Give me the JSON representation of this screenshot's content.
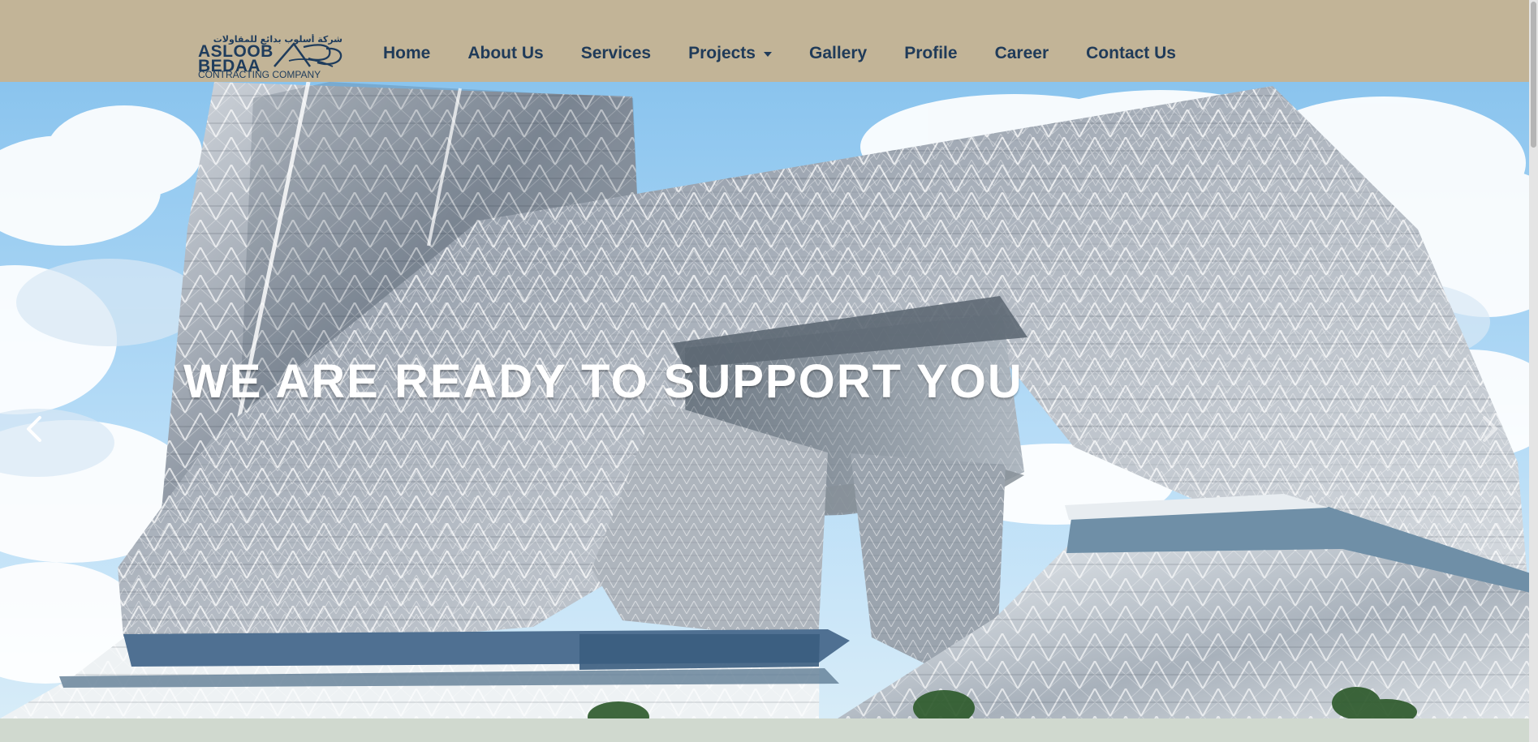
{
  "logo": {
    "arabic_name": "شركة أسلوب بدائع للمقاولات",
    "line1": "ASLOOB",
    "line2": "BEDAA",
    "line3": "CONTRACTING COMPANY",
    "mark": "ABC"
  },
  "nav": {
    "items": [
      {
        "label": "Home"
      },
      {
        "label": "About Us"
      },
      {
        "label": "Services"
      },
      {
        "label": "Projects",
        "dropdown": true
      },
      {
        "label": "Gallery"
      },
      {
        "label": "Profile"
      },
      {
        "label": "Career"
      },
      {
        "label": "Contact Us"
      }
    ]
  },
  "hero": {
    "headline": "WE ARE READY TO SUPPORT YOU"
  },
  "carousel": {
    "prev_icon": "chevron-left-icon",
    "next_icon": "chevron-right-icon"
  },
  "colors": {
    "header_bg": "#c2b497",
    "nav_text": "#203b59",
    "bottom_strip": "#d0d9cf"
  }
}
